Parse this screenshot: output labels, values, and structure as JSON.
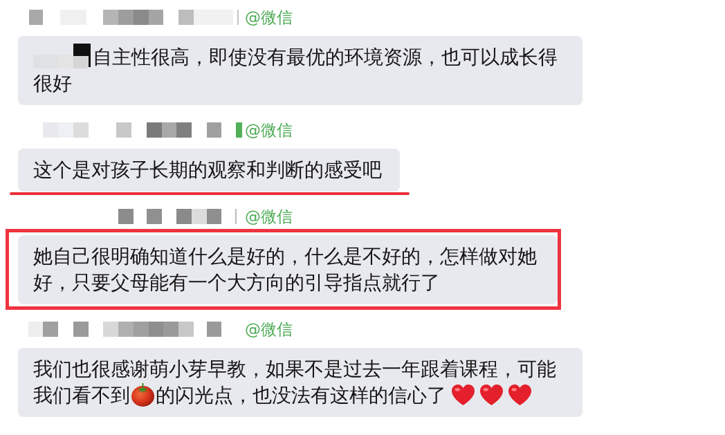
{
  "messages": [
    {
      "sender_tag": "@微信",
      "parts": [
        {
          "kind": "redacted"
        },
        {
          "kind": "text",
          "text": "自主性很高，即使没有最优的环境资源，也可以成长得很好"
        }
      ],
      "underlined": false,
      "boxed": false
    },
    {
      "sender_tag": "@微信",
      "parts": [
        {
          "kind": "text",
          "text": "这个是对孩子长期的观察和判断的感受吧"
        }
      ],
      "underlined": true,
      "boxed": false
    },
    {
      "sender_tag": "@微信",
      "parts": [
        {
          "kind": "text",
          "text": "她自己很明确知道什么是好的，什么是不好的，怎样做对她好，只要父母能有一个大方向的引导指点就行了"
        }
      ],
      "underlined": false,
      "boxed": true
    },
    {
      "sender_tag": "@微信",
      "parts": [
        {
          "kind": "text",
          "text": "我们也很感谢萌小芽早教，如果不是过去一年跟着课程，可能我们看不到"
        },
        {
          "kind": "tomato"
        },
        {
          "kind": "text",
          "text": "的闪光点，也没法有这样的信心了"
        },
        {
          "kind": "heart"
        },
        {
          "kind": "heart"
        },
        {
          "kind": "heart"
        }
      ],
      "underlined": false,
      "boxed": false
    }
  ]
}
